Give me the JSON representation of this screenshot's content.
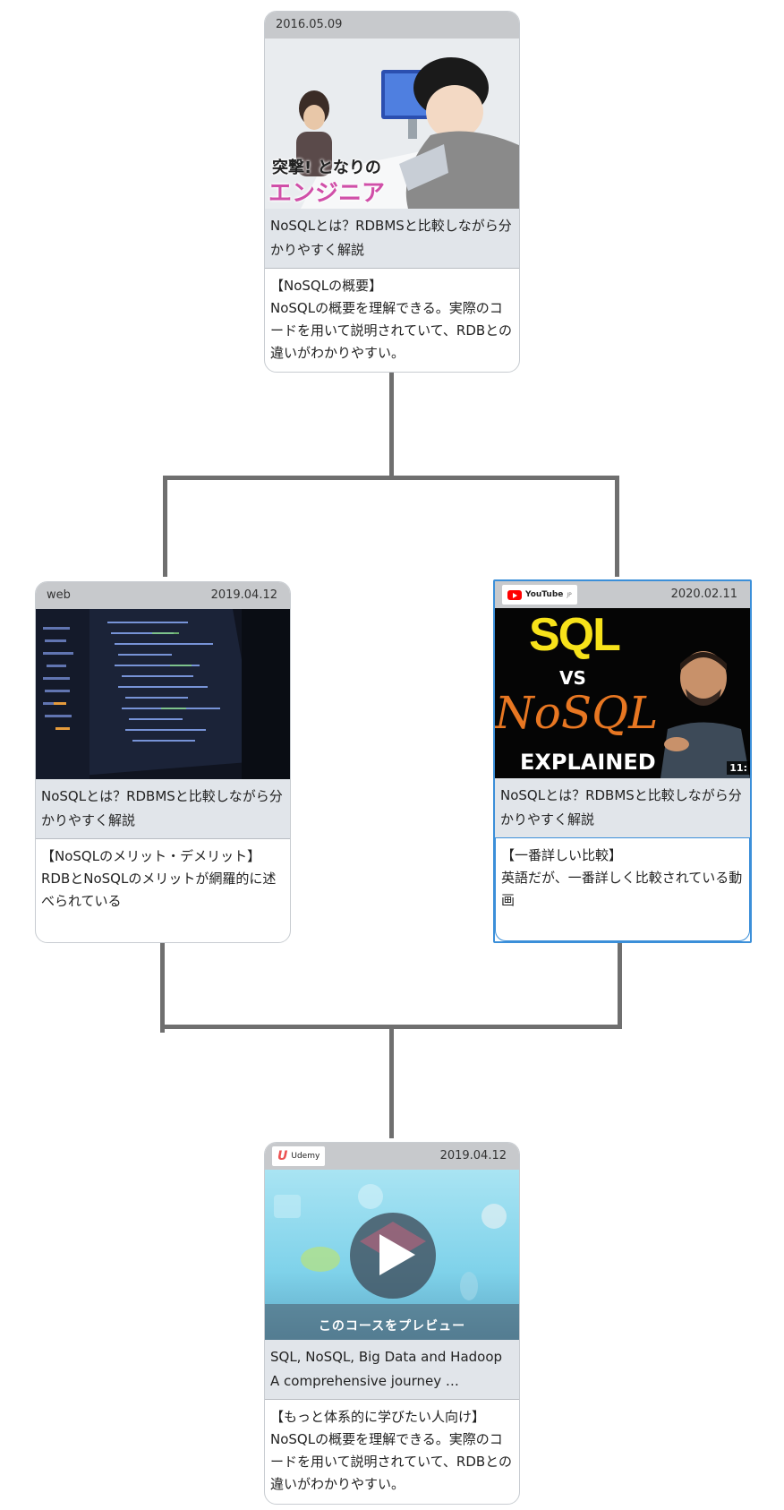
{
  "cards": {
    "top": {
      "date": "2016.05.09",
      "thumb_caption_1": "突撃! となりの",
      "thumb_caption_2": "エンジニア",
      "title": "NoSQLとは？RDBMSと比較しながら分かりやすく解説",
      "description": "【NoSQLの概要】\nNoSQLの概要を理解できる。実際のコードを用いて説明されていて、RDBとの違いがわかりやすい。"
    },
    "left": {
      "source": "web",
      "date": "2019.04.12",
      "title": "NoSQLとは？RDBMSと比較しながら分かりやすく解説",
      "description": "【NoSQLのメリット・デメリット】\nRDBとNoSQLのメリットが網羅的に述べられている"
    },
    "right": {
      "source": "YouTube",
      "source_suffix": "JP",
      "date": "2020.02.11",
      "thumb_text_1": "SQL",
      "thumb_text_2": "VS",
      "thumb_text_3": "NoSQL",
      "thumb_text_4": "EXPLAINED",
      "thumb_duration": "11:",
      "title": "NoSQLとは？RDBMSと比較しながら分かりやすく解説",
      "description": "【一番詳しい比較】\n英語だが、一番詳しく比較されている動画"
    },
    "bottom": {
      "source": "Udemy",
      "date": "2019.04.12",
      "thumb_caption": "このコースをプレビュー",
      "title": "SQL, NoSQL, Big Data and Hadoop A comprehensive journey …",
      "description": "【もっと体系的に学びたい人向け】\nNoSQLの概要を理解できる。実際のコードを用いて説明されていて、RDBとの違いがわかりやすい。"
    }
  },
  "colors": {
    "connector": "#6f6f6f",
    "header": "#c7c9cc",
    "title_bg": "#e1e5ea",
    "selected_border": "#3b8fd9"
  }
}
